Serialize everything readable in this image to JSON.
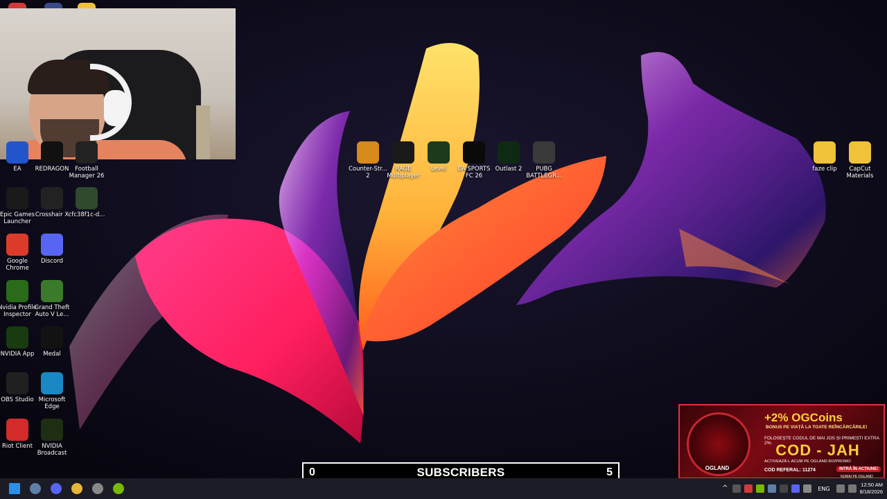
{
  "desktop": {
    "left_icons": [
      {
        "label": "EA",
        "icon": "ea-icon",
        "color": "#2255cc"
      },
      {
        "label": "REDRAGON",
        "icon": "redragon-icon",
        "color": "#111111"
      },
      {
        "label": "Football Manager 26",
        "icon": "football-manager-icon",
        "color": "#222222"
      },
      {
        "label": "Epic Games Launcher",
        "icon": "epic-games-icon",
        "color": "#1a1a1a"
      },
      {
        "label": "Crosshair X",
        "icon": "crosshair-x-icon",
        "color": "#222222"
      },
      {
        "label": "cfc38f1c-d...",
        "icon": "image-file-icon",
        "color": "#2f4a2f"
      },
      {
        "label": "Google Chrome",
        "icon": "chrome-icon",
        "color": "#dd3b2a"
      },
      {
        "label": "Discord",
        "icon": "discord-icon",
        "color": "#5865f2"
      },
      {
        "label": "Nvidia Profile Inspector",
        "icon": "nvidia-profile-inspector-icon",
        "color": "#2a6b1a"
      },
      {
        "label": "Grand Theft Auto V Le...",
        "icon": "gta-v-icon",
        "color": "#3a7a2a"
      },
      {
        "label": "NVIDIA App",
        "icon": "nvidia-app-icon",
        "color": "#1a3a10"
      },
      {
        "label": "Medal",
        "icon": "medal-icon",
        "color": "#121212"
      },
      {
        "label": "OBS Studio",
        "icon": "obs-studio-icon",
        "color": "#202020"
      },
      {
        "label": "Microsoft Edge",
        "icon": "edge-icon",
        "color": "#1a88c4"
      },
      {
        "label": "Riot Client",
        "icon": "riot-client-icon",
        "color": "#d32a2a"
      },
      {
        "label": "NVIDIA Broadcast",
        "icon": "nvidia-broadcast-icon",
        "color": "#1e2e12"
      }
    ],
    "top_icons": [
      {
        "label": "Counter-Str... 2",
        "icon": "cs2-icon",
        "color": "#d88a1a"
      },
      {
        "label": "RAGE Multiplayer",
        "icon": "rage-mp-icon",
        "color": "#1a1a1a"
      },
      {
        "label": "Level",
        "icon": "level-icon",
        "color": "#1c3a1c"
      },
      {
        "label": "EA SPORTS FC 26",
        "icon": "ea-fc26-icon",
        "color": "#0a0a0a"
      },
      {
        "label": "Outlast 2",
        "icon": "outlast-2-icon",
        "color": "#0f2a12"
      },
      {
        "label": "PUBG BATTLEGR...",
        "icon": "pubg-icon",
        "color": "#3a3a3a"
      }
    ],
    "right_icons": [
      {
        "label": "faze clip",
        "icon": "folder-icon",
        "color": "#f0c23a"
      },
      {
        "label": "CapCut Materials",
        "icon": "folder-icon",
        "color": "#f0c23a"
      }
    ]
  },
  "subscriber_bar": {
    "start": "0",
    "title": "SUBSCRIBERS",
    "end": "5"
  },
  "promo": {
    "headline": "+2% OGCoins",
    "subline": "BONUS PE VIAȚĂ LA TOATE REÎNCĂRCĂRILE!",
    "info": "FOLOSEȘTE CODUL DE MAI JOS ȘI PRIMEȘTI EXTRA 2%:",
    "code": "COD - JAH",
    "activate": "ACTIVEAZĂ-L ACUM PE OGLAND.RO/PROMO",
    "ref_label": "COD REFERAL:",
    "ref_value": "11274",
    "cta": "INTRĂ ÎN ACȚIUNE!",
    "cta2": "NUMAI PE OGLAND",
    "brand": "OGLAND"
  },
  "taskbar": {
    "apps": [
      {
        "name": "windows-start-icon",
        "color": "#2b8fe8"
      },
      {
        "name": "steam-icon",
        "color": "#5f7ea8"
      },
      {
        "name": "discord-icon",
        "color": "#5865f2"
      },
      {
        "name": "chrome-icon",
        "color": "#e8b53a"
      },
      {
        "name": "obs-icon",
        "color": "#888888"
      },
      {
        "name": "nvidia-broadcast-icon",
        "color": "#76b900"
      }
    ],
    "language": "ENG",
    "time": "12:50 AM",
    "date": "8/18/2026"
  }
}
